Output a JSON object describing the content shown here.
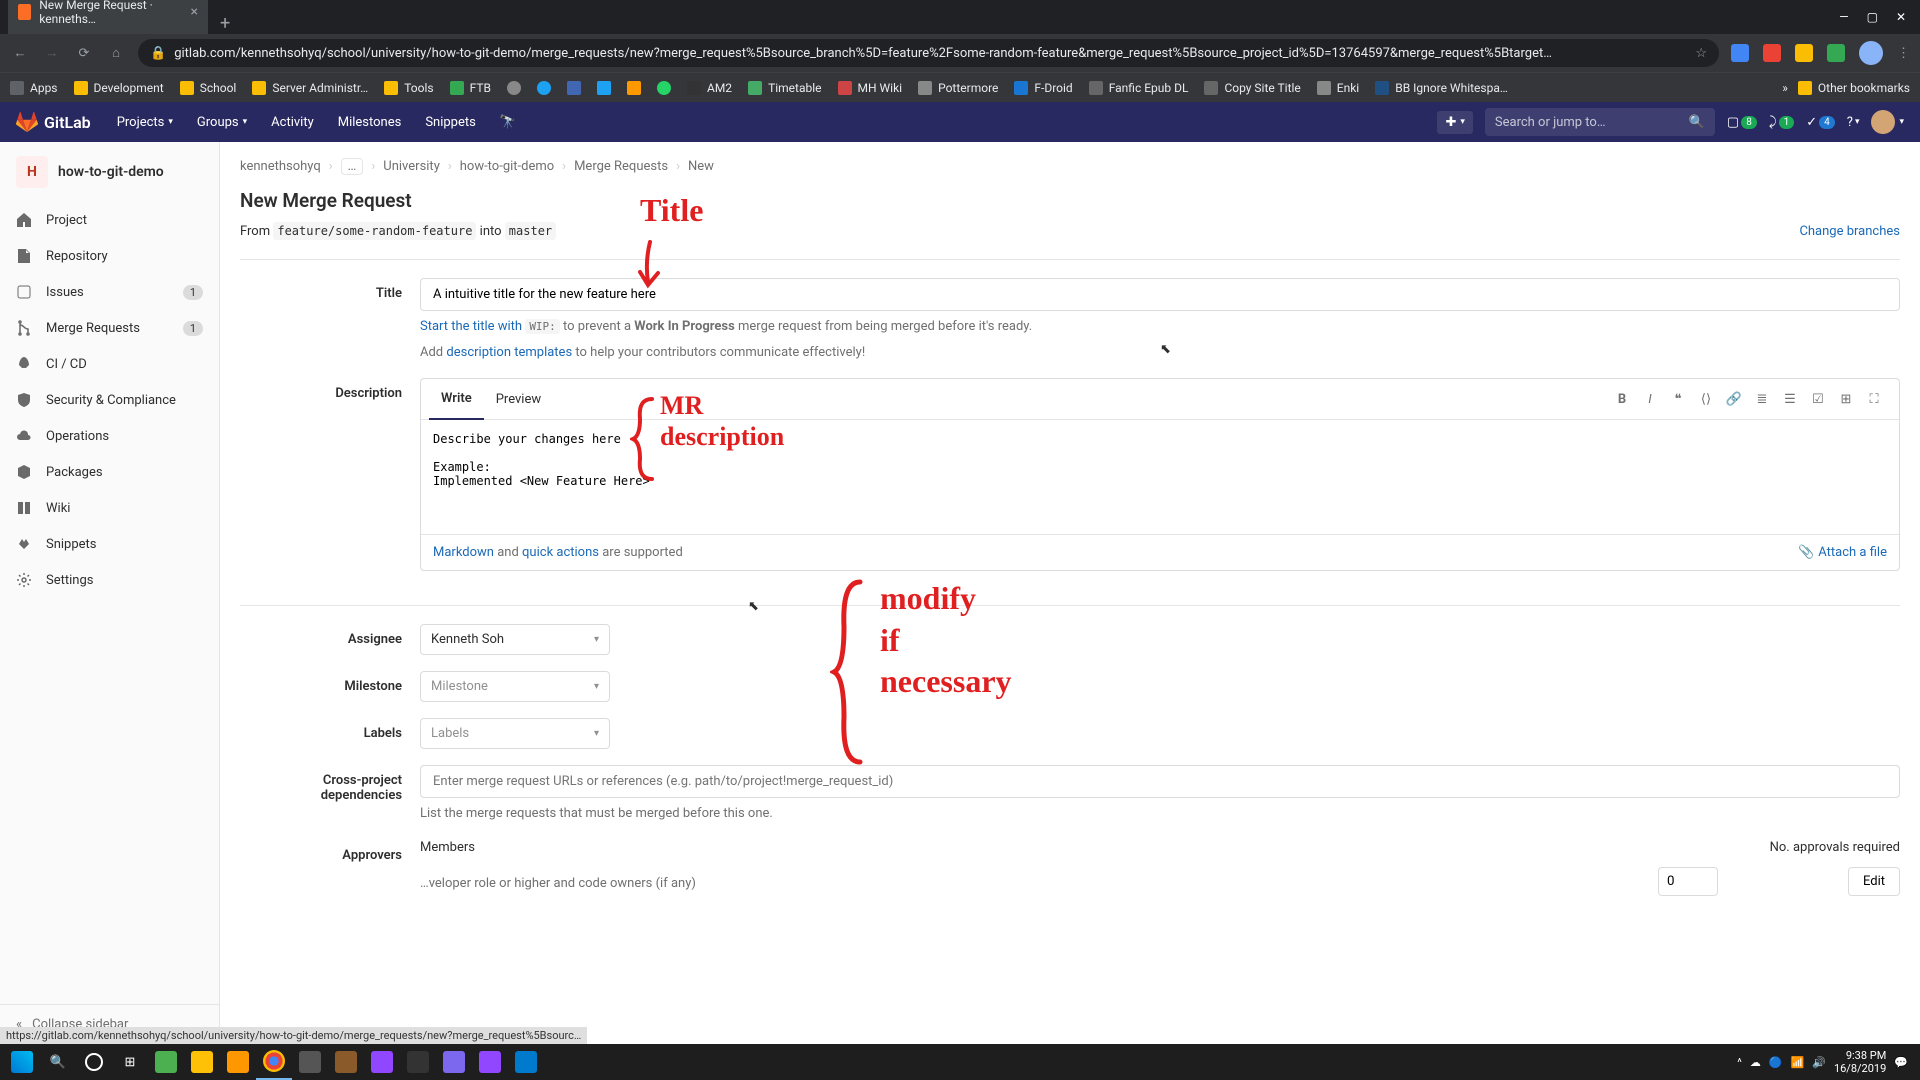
{
  "browser": {
    "tab_title": "New Merge Request · kenneths…",
    "url": "gitlab.com/kennethsohyq/school/university/how-to-git-demo/merge_requests/new?merge_request%5Bsource_branch%5D=feature%2Fsome-random-feature&merge_request%5Bsource_project_id%5D=13764597&merge_request%5Btarget…",
    "bookmarks": [
      "Apps",
      "Development",
      "School",
      "Server Administr…",
      "Tools",
      "FTB",
      "",
      "",
      "",
      "",
      "",
      "AM2",
      "Timetable",
      "MH Wiki",
      "Pottermore",
      "F-Droid",
      "Fanfic Epub DL",
      "Copy Site Title",
      "Enki",
      "BB Ignore Whitespa…"
    ],
    "other_bookmarks": "Other bookmarks"
  },
  "gitlab_header": {
    "brand": "GitLab",
    "nav": [
      "Projects",
      "Groups",
      "Activity",
      "Milestones",
      "Snippets"
    ],
    "search_placeholder": "Search or jump to…",
    "counts": {
      "issues": "8",
      "mrs": "1",
      "todos": "4"
    }
  },
  "sidebar": {
    "project_initial": "H",
    "project_name": "how-to-git-demo",
    "items": [
      {
        "label": "Project",
        "icon": "home"
      },
      {
        "label": "Repository",
        "icon": "files"
      },
      {
        "label": "Issues",
        "icon": "issues",
        "badge": "1"
      },
      {
        "label": "Merge Requests",
        "icon": "merge",
        "badge": "1"
      },
      {
        "label": "CI / CD",
        "icon": "rocket"
      },
      {
        "label": "Security & Compliance",
        "icon": "shield"
      },
      {
        "label": "Operations",
        "icon": "cloud"
      },
      {
        "label": "Packages",
        "icon": "package"
      },
      {
        "label": "Wiki",
        "icon": "book"
      },
      {
        "label": "Snippets",
        "icon": "snippet"
      },
      {
        "label": "Settings",
        "icon": "gear"
      }
    ],
    "collapse": "Collapse sidebar"
  },
  "breadcrumbs": {
    "items": [
      "kennethsohyq",
      "…",
      "University",
      "how-to-git-demo",
      "Merge Requests",
      "New"
    ]
  },
  "page": {
    "title": "New Merge Request",
    "from_label": "From",
    "source_branch": "feature/some-random-feature",
    "into_label": "into",
    "target_branch": "master",
    "change_branches": "Change branches"
  },
  "form": {
    "title_label": "Title",
    "title_value": "A intuitive title for the new feature here",
    "wip_hint_prefix": "Start the title with",
    "wip_tag": "WIP:",
    "wip_hint_mid": "to prevent a",
    "wip_bold": "Work In Progress",
    "wip_hint_suffix": "merge request from being merged before it's ready.",
    "template_hint_prefix": "Add",
    "template_link": "description templates",
    "template_hint_suffix": "to help your contributors communicate effectively!",
    "desc_label": "Description",
    "write_tab": "Write",
    "preview_tab": "Preview",
    "desc_value": "Describe your changes here\n\nExample:\nImplemented <New Feature Here>",
    "markdown_link": "Markdown",
    "and_text": "and",
    "quick_link": "quick actions",
    "supported_text": "are supported",
    "attach_link": "Attach a file",
    "assignee_label": "Assignee",
    "assignee_value": "Kenneth Soh",
    "milestone_label": "Milestone",
    "milestone_placeholder": "Milestone",
    "labels_label": "Labels",
    "labels_placeholder": "Labels",
    "xproject_label": "Cross-project dependencies",
    "xproject_placeholder": "Enter merge request URLs or references (e.g. path/to/project!merge_request_id)",
    "xproject_hint": "List the merge requests that must be merged before this one.",
    "approvers_label": "Approvers",
    "approvers_members": "Members",
    "approvers_hint": "…veloper role or higher and code owners (if any)",
    "no_approvals": "No. approvals required",
    "approvals_value": "0",
    "edit_btn": "Edit"
  },
  "annotations": {
    "title": "Title",
    "desc": "MR\ndescription",
    "modify": "modify\nif\nnecessary"
  },
  "status_bar": "https://gitlab.com/kennethsohyq/school/university/how-to-git-demo/merge_requests/new?merge_request%5Bsourc…",
  "taskbar": {
    "time": "9:38 PM",
    "date": "16/8/2019"
  }
}
